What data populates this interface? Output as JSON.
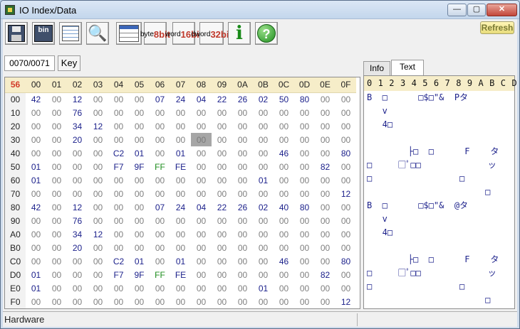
{
  "window": {
    "title": "IO Index/Data",
    "controls": {
      "minimize": "—",
      "maximize": "▢",
      "close": "✕"
    }
  },
  "toolbar": {
    "buttons": [
      {
        "name": "save-icon",
        "icon": "floppy-icon"
      },
      {
        "name": "save-bin-icon",
        "icon": "bin-icon",
        "text": "bin"
      },
      {
        "name": "save-table-icon",
        "icon": "grid-icon"
      },
      {
        "name": "find-icon",
        "icon": "binoculars-icon"
      },
      {
        "name": "table-view-icon",
        "icon": "table-icon"
      }
    ],
    "byte": {
      "top": "byte",
      "bottom": "8bit",
      "color": "#c0392b"
    },
    "word": {
      "top": "word",
      "bottom": "16bit",
      "color": "#c0392b"
    },
    "dword": {
      "top": "dword",
      "bottom": "32bit",
      "color": "#c0392b"
    },
    "info_label": "i",
    "help_label": "?",
    "refresh_label": "Refresh"
  },
  "address": {
    "value": "0070/0071",
    "key_label": "Key"
  },
  "grid": {
    "corner": "56",
    "columns": [
      "00",
      "01",
      "02",
      "03",
      "04",
      "05",
      "06",
      "07",
      "08",
      "09",
      "0A",
      "0B",
      "0C",
      "0D",
      "0E",
      "0F"
    ],
    "rows": [
      {
        "label": "00",
        "cells": [
          "42",
          "00",
          "12",
          "00",
          "00",
          "00",
          "07",
          "24",
          "04",
          "22",
          "26",
          "02",
          "50",
          "80",
          "00",
          "00"
        ]
      },
      {
        "label": "10",
        "cells": [
          "00",
          "00",
          "76",
          "00",
          "00",
          "00",
          "00",
          "00",
          "00",
          "00",
          "00",
          "00",
          "00",
          "00",
          "00",
          "00"
        ]
      },
      {
        "label": "20",
        "cells": [
          "00",
          "00",
          "34",
          "12",
          "00",
          "00",
          "00",
          "00",
          "00",
          "00",
          "00",
          "00",
          "00",
          "00",
          "00",
          "00"
        ]
      },
      {
        "label": "30",
        "cells": [
          "00",
          "00",
          "20",
          "00",
          "00",
          "00",
          "00",
          "00",
          "00",
          "00",
          "00",
          "00",
          "00",
          "00",
          "00",
          "00"
        ]
      },
      {
        "label": "40",
        "cells": [
          "00",
          "00",
          "00",
          "00",
          "C2",
          "01",
          "00",
          "01",
          "00",
          "00",
          "00",
          "00",
          "46",
          "00",
          "00",
          "80"
        ]
      },
      {
        "label": "50",
        "cells": [
          "01",
          "00",
          "00",
          "00",
          "F7",
          "9F",
          "FF",
          "FE",
          "00",
          "00",
          "00",
          "00",
          "00",
          "00",
          "82",
          "00"
        ]
      },
      {
        "label": "60",
        "cells": [
          "01",
          "00",
          "00",
          "00",
          "00",
          "00",
          "00",
          "00",
          "00",
          "00",
          "00",
          "01",
          "00",
          "00",
          "00",
          "00"
        ]
      },
      {
        "label": "70",
        "cells": [
          "00",
          "00",
          "00",
          "00",
          "00",
          "00",
          "00",
          "00",
          "00",
          "00",
          "00",
          "00",
          "00",
          "00",
          "00",
          "12"
        ]
      },
      {
        "label": "80",
        "cells": [
          "42",
          "00",
          "12",
          "00",
          "00",
          "00",
          "07",
          "24",
          "04",
          "22",
          "26",
          "02",
          "40",
          "80",
          "00",
          "00"
        ]
      },
      {
        "label": "90",
        "cells": [
          "00",
          "00",
          "76",
          "00",
          "00",
          "00",
          "00",
          "00",
          "00",
          "00",
          "00",
          "00",
          "00",
          "00",
          "00",
          "00"
        ]
      },
      {
        "label": "A0",
        "cells": [
          "00",
          "00",
          "34",
          "12",
          "00",
          "00",
          "00",
          "00",
          "00",
          "00",
          "00",
          "00",
          "00",
          "00",
          "00",
          "00"
        ]
      },
      {
        "label": "B0",
        "cells": [
          "00",
          "00",
          "20",
          "00",
          "00",
          "00",
          "00",
          "00",
          "00",
          "00",
          "00",
          "00",
          "00",
          "00",
          "00",
          "00"
        ]
      },
      {
        "label": "C0",
        "cells": [
          "00",
          "00",
          "00",
          "00",
          "C2",
          "01",
          "00",
          "01",
          "00",
          "00",
          "00",
          "00",
          "46",
          "00",
          "00",
          "80"
        ]
      },
      {
        "label": "D0",
        "cells": [
          "01",
          "00",
          "00",
          "00",
          "F7",
          "9F",
          "FF",
          "FE",
          "00",
          "00",
          "00",
          "00",
          "00",
          "00",
          "82",
          "00"
        ]
      },
      {
        "label": "E0",
        "cells": [
          "01",
          "00",
          "00",
          "00",
          "00",
          "00",
          "00",
          "00",
          "00",
          "00",
          "00",
          "01",
          "00",
          "00",
          "00",
          "00"
        ]
      },
      {
        "label": "F0",
        "cells": [
          "00",
          "00",
          "00",
          "00",
          "00",
          "00",
          "00",
          "00",
          "00",
          "00",
          "00",
          "00",
          "00",
          "00",
          "00",
          "12"
        ]
      }
    ],
    "selected": {
      "row": "30",
      "col": "08"
    },
    "green_value": "FF"
  },
  "tabs": [
    {
      "label": "Info",
      "active": false
    },
    {
      "label": "Text",
      "active": true
    }
  ],
  "text_panel": {
    "header": "0 1 2 3 4 5 6 7 8 9 A B C D E F",
    "rows": [
      "B  □      □$□\"&  Pタ",
      "   v",
      "   4□",
      "",
      "        ├□  □      F    タ",
      "□     □ﾟ□□             ッ",
      "□                 □",
      "                       □",
      "B  □      □$□\"&  @タ",
      "   v",
      "   4□",
      "",
      "        ├□  □      F    タ",
      "□     □ﾟ□□             ッ",
      "□                 □",
      "                       □"
    ]
  },
  "status": {
    "text": "Hardware"
  }
}
